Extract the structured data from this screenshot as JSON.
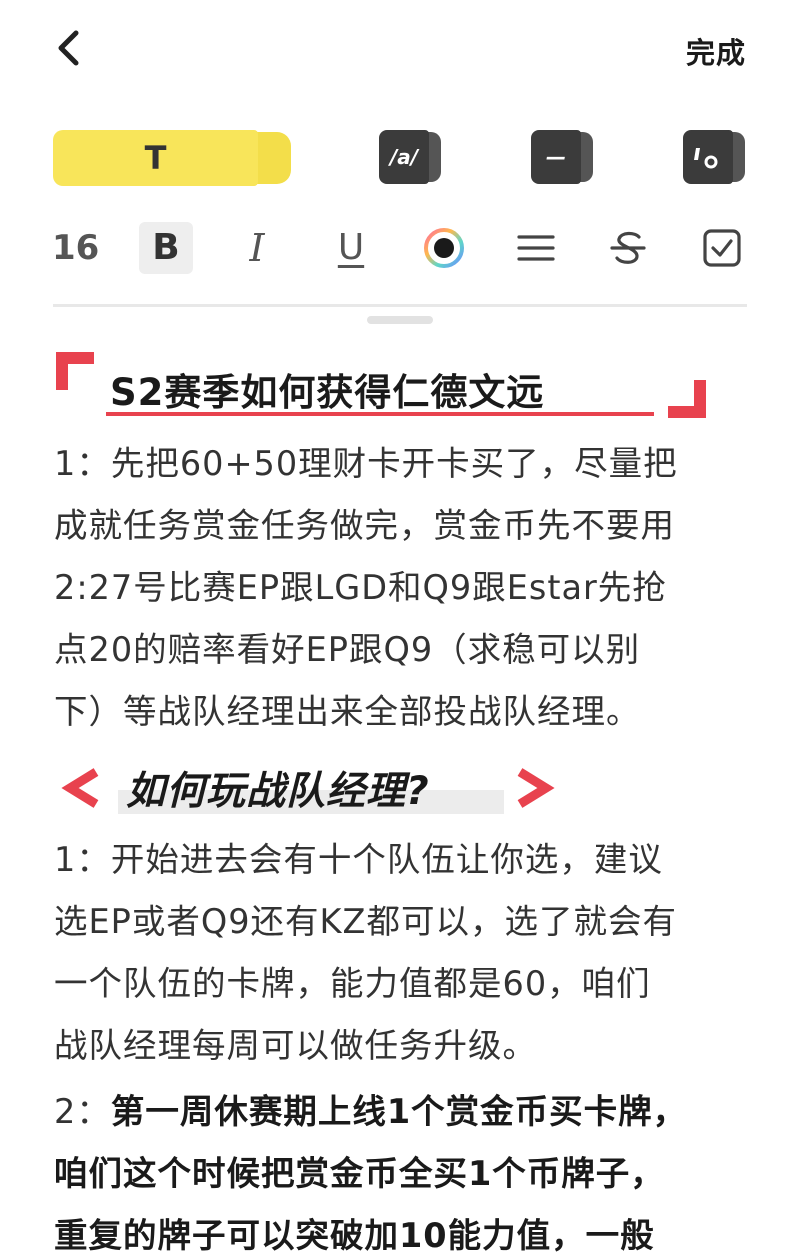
{
  "header": {
    "done_label": "完成"
  },
  "style_tabs": [
    {
      "label": "T",
      "active": true
    },
    {
      "label": "/a/",
      "active": false
    },
    {
      "label": "—",
      "active": false
    },
    {
      "label": "quote",
      "active": false
    }
  ],
  "toolbar": {
    "font_size": "16",
    "bold": "B",
    "italic": "I",
    "underline": "U"
  },
  "colors": {
    "accent_yellow": "#f8e55a",
    "heading_red": "#e8424e",
    "icon_dark": "#3b3b3b"
  },
  "content": {
    "title": "S2赛季如何获得仁德文远",
    "para1": [
      "1：先把60+50理财卡开卡买了，尽量把",
      "成就任务赏金任务做完，赏金币先不要用",
      "2:27号比赛EP跟LGD和Q9跟Estar先抢",
      "点20的赔率看好EP跟Q9（求稳可以别",
      "下）等战队经理出来全部投战队经理。"
    ],
    "subtitle": "如何玩战队经理?",
    "para2": [
      "1：开始进去会有十个队伍让你选，建议",
      "选EP或者Q9还有KZ都可以，选了就会有",
      "一个队伍的卡牌，能力值都是60，咱们",
      "战队经理每周可以做任务升级。"
    ],
    "para3_prefix": "2：",
    "para3_bold": [
      "第一周休赛期上线1个赏金币买卡牌，",
      "咱们这个时候把赏金币全买1个币牌子，",
      "重复的牌子可以突破加10能力值，一般"
    ]
  }
}
